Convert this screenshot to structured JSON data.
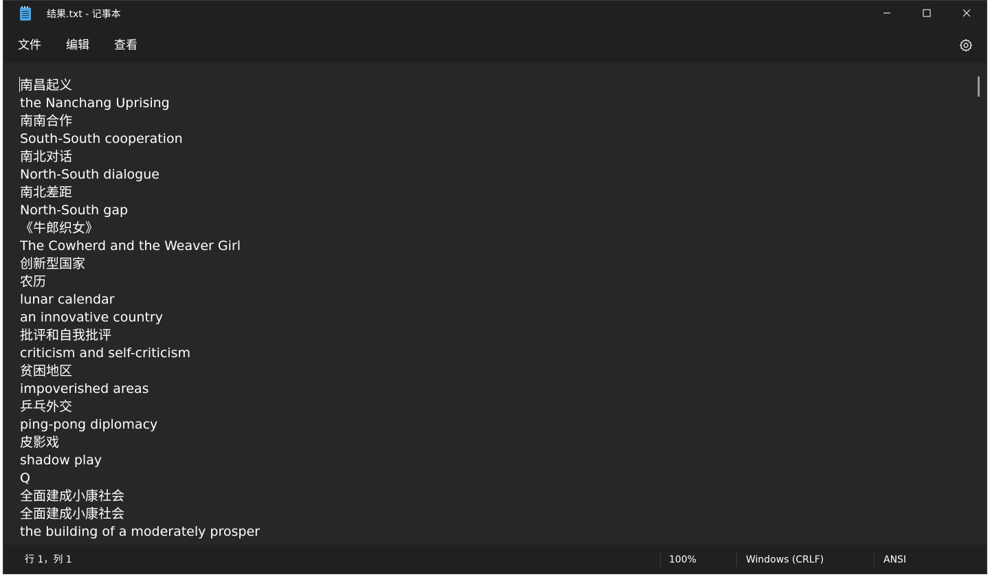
{
  "window": {
    "title": "结果.txt - 记事本"
  },
  "menu": {
    "file": "文件",
    "edit": "编辑",
    "view": "查看"
  },
  "icons": {
    "app": "notepad-icon",
    "minimize": "minimize-icon",
    "maximize": "maximize-icon",
    "close": "close-icon",
    "settings": "gear-icon"
  },
  "editor": {
    "lines": [
      "南昌起义",
      "the Nanchang Uprising",
      "南南合作",
      "South-South cooperation",
      "南北对话",
      "North-South dialogue",
      "南北差距",
      "North-South gap",
      "《牛郎织女》",
      "The Cowherd and the Weaver Girl",
      "创新型国家",
      "农历",
      "lunar calendar",
      "an innovative country",
      "批评和自我批评",
      "criticism and self-criticism",
      "贫困地区",
      "impoverished areas",
      "乒乓外交",
      "ping-pong diplomacy",
      "皮影戏",
      "shadow play",
      "Q",
      "全面建成小康社会",
      "全面建成小康社会",
      "the building of a moderately prosper"
    ]
  },
  "status": {
    "position": "行 1，列 1",
    "zoom": "100%",
    "line_ending": "Windows (CRLF)",
    "encoding": "ANSI"
  },
  "colors": {
    "background": "#272727",
    "chrome": "#202020",
    "text": "#ffffff"
  }
}
